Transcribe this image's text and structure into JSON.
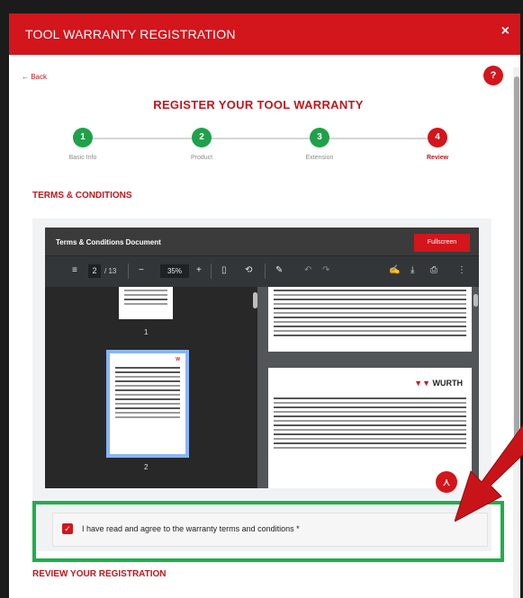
{
  "modal": {
    "title": "TOOL WARRANTY REGISTRATION",
    "close_icon": "×"
  },
  "nav": {
    "back_label": "← Back",
    "help_label": "?"
  },
  "heading": "REGISTER YOUR TOOL WARRANTY",
  "steps": [
    {
      "number": "1",
      "label": "Basic Info",
      "state": "done"
    },
    {
      "number": "2",
      "label": "Product",
      "state": "done"
    },
    {
      "number": "3",
      "label": "Extension",
      "state": "done"
    },
    {
      "number": "4",
      "label": "Review",
      "state": "active"
    }
  ],
  "terms": {
    "section_title": "TERMS & CONDITIONS",
    "document_title": "Terms & Conditions Document",
    "fullscreen_label": "Fullscreen"
  },
  "pdf": {
    "current_page": "2",
    "total_pages": "/ 13",
    "zoom": "35%",
    "thumbnails": [
      {
        "number": "1"
      },
      {
        "number": "2"
      }
    ],
    "logo_text": "WURTH"
  },
  "agreement": {
    "label": "I have read and agree to the warranty terms and conditions *",
    "checked": true
  },
  "review": {
    "section_title": "REVIEW YOUR REGISTRATION"
  },
  "colors": {
    "brand_red": "#d3151c",
    "step_done": "#1fa14a",
    "highlight_green": "#1fae4a"
  }
}
